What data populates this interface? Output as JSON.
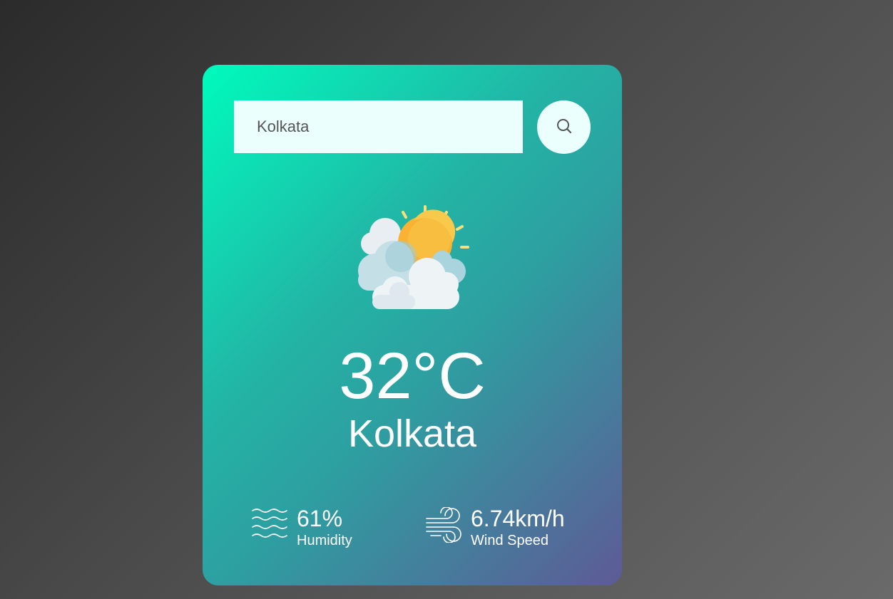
{
  "search": {
    "value": "Kolkata",
    "button_icon": "search-icon"
  },
  "weather": {
    "icon": "partly-cloudy-icon",
    "temperature": "32°C",
    "city": "Kolkata"
  },
  "humidity": {
    "icon": "humidity-waves-icon",
    "value": "61%",
    "label": "Humidity"
  },
  "wind": {
    "icon": "wind-icon",
    "value": "6.74km/h",
    "label": "Wind Speed"
  },
  "colors": {
    "card_gradient_start": "#00fbbd",
    "card_gradient_end": "#5e5a96",
    "input_background": "#ebfffc",
    "sun": "#f9b233"
  }
}
